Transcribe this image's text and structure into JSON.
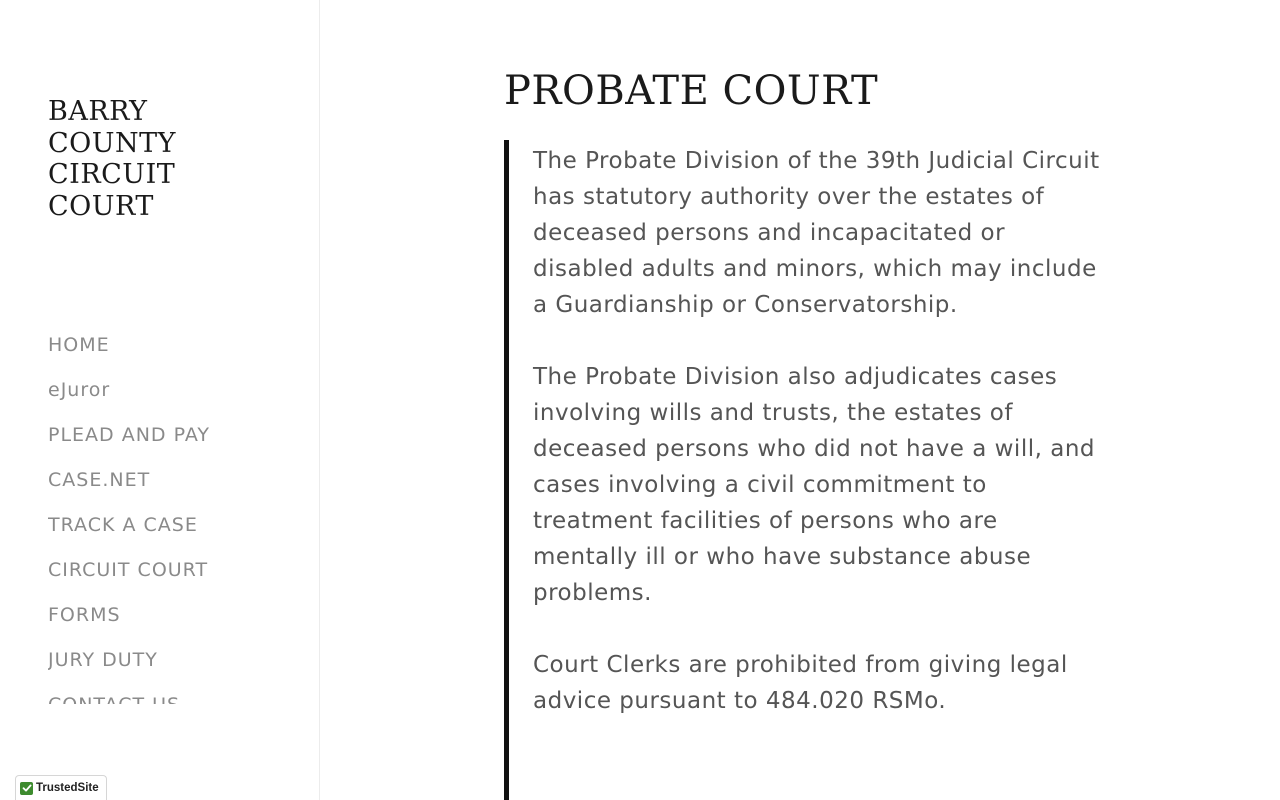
{
  "sidebar": {
    "site_title_lines": [
      "BARRY",
      "COUNTY",
      "CIRCUIT",
      "COURT"
    ],
    "nav_items": [
      {
        "label": "HOME"
      },
      {
        "label": "eJuror"
      },
      {
        "label": "PLEAD AND PAY"
      },
      {
        "label": "CASE.NET"
      },
      {
        "label": "TRACK A CASE"
      },
      {
        "label": "CIRCUIT COURT"
      },
      {
        "label": "FORMS"
      },
      {
        "label": "JURY DUTY"
      },
      {
        "label": "CONTACT US"
      }
    ]
  },
  "main": {
    "title": "PROBATE COURT",
    "paragraphs": [
      "The Probate Division of the 39th Judicial Circuit has statutory authority over the estates of deceased persons and incapacitated or disabled adults and minors, which may include a Guardianship or Conservatorship.",
      "The Probate Division also adjudicates cases involving wills and trusts, the estates of deceased persons who did not have a will, and cases involving a civil commitment to treatment facilities of persons who are mentally ill or who have substance abuse problems.",
      "Court Clerks are prohibited from giving legal advice pursuant to 484.020 RSMo."
    ]
  },
  "badge": {
    "label": "TrustedSite",
    "icon": "check-icon"
  },
  "colors": {
    "title": "#1a1a1a",
    "nav_text": "#8a8a8a",
    "body_text": "#555555",
    "quote_bar": "#111111",
    "badge_check": "#3d8b2e"
  }
}
